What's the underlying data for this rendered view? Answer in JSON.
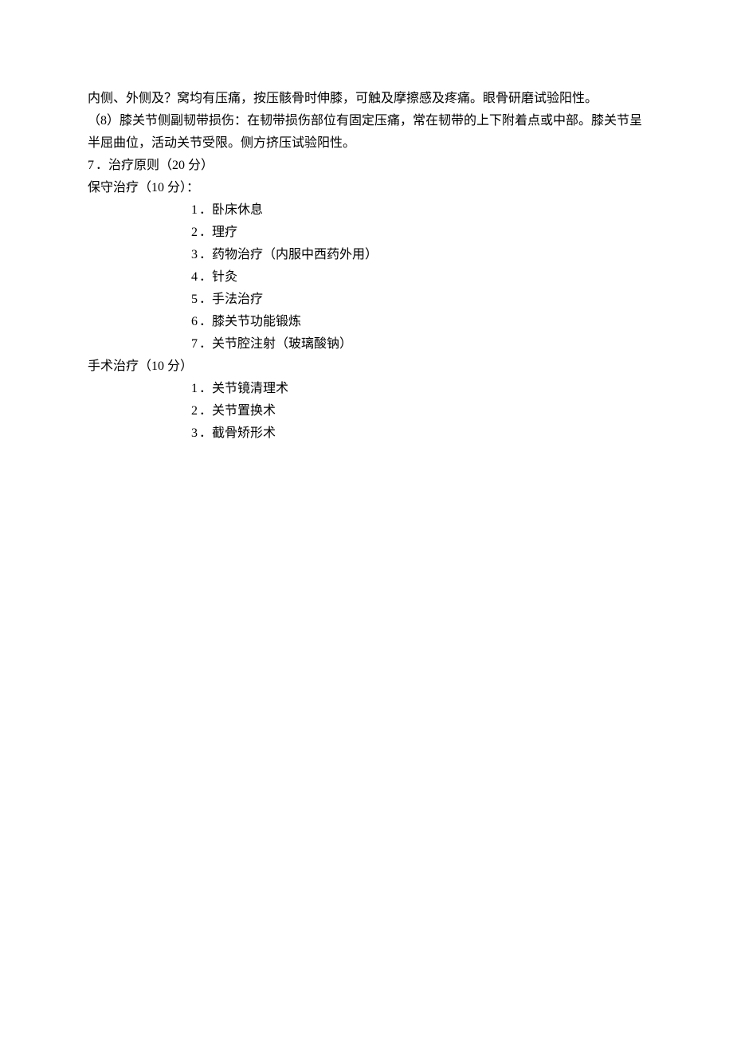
{
  "p1": "内侧、外侧及？窝均有压痛，按压骸骨时伸膝，可触及摩擦感及疼痛。眼骨研磨试验阳性。",
  "p2": "（8）膝关节侧副韧带损伤：在韧带损伤部位有固定压痛，常在韧带的上下附着点或中部。膝关节呈半屈曲位，活动关节受限。侧方挤压试验阳性。",
  "section7_num": "7",
  "section7_label": "．治疗原则（20 分）",
  "conservative_label": "保守治疗（10 分）：",
  "conservative_items": [
    {
      "num": "1",
      "text": "．卧床休息"
    },
    {
      "num": "2",
      "text": "．理疗"
    },
    {
      "num": "3",
      "text": "．药物治疗（内服中西药外用）"
    },
    {
      "num": "4",
      "text": "．针灸"
    },
    {
      "num": "5",
      "text": "．手法治疗"
    },
    {
      "num": "6",
      "text": "．膝关节功能锻炼"
    },
    {
      "num": "7",
      "text": "．关节腔注射（玻璃酸钠）"
    }
  ],
  "surgery_label": "手术治疗（10 分）",
  "surgery_items": [
    {
      "num": "1",
      "text": "．关节镜清理术"
    },
    {
      "num": "2",
      "text": "．关节置换术"
    },
    {
      "num": "3",
      "text": "．截骨矫形术"
    }
  ]
}
